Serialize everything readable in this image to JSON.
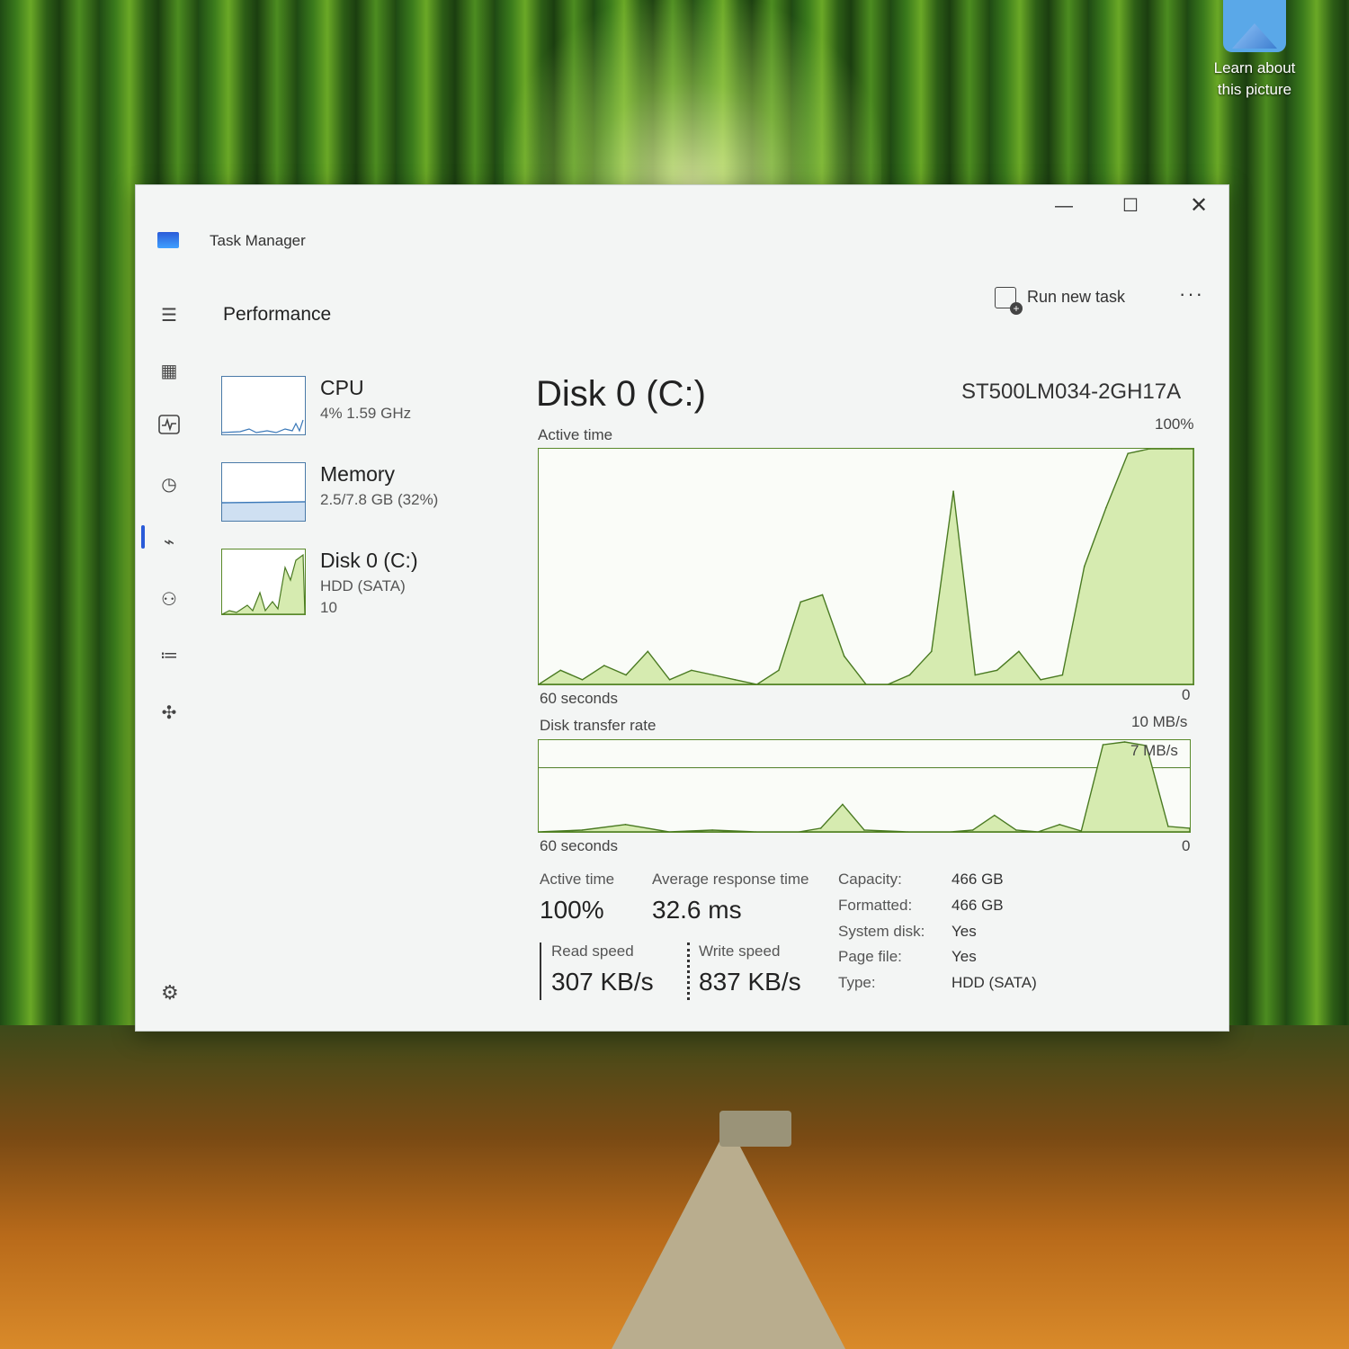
{
  "desktop": {
    "icon_label_line1": "Learn about",
    "icon_label_line2": "this picture"
  },
  "window": {
    "title": "Task Manager",
    "controls": {
      "minimize": "—",
      "maximize": "☐",
      "close": "✕"
    }
  },
  "nav": {
    "icons": [
      "menu-icon",
      "processes-icon",
      "performance-icon",
      "app-history-icon",
      "startup-apps-icon",
      "users-icon",
      "details-icon",
      "services-icon"
    ],
    "active": "performance-icon",
    "settings_icon": "gear-icon"
  },
  "page": {
    "title": "Performance",
    "run_new_task": "Run new task",
    "more": "···"
  },
  "devices": [
    {
      "name": "CPU",
      "sub": "4% 1.59 GHz"
    },
    {
      "name": "Memory",
      "sub": "2.5/7.8 GB (32%)"
    },
    {
      "name": "Disk 0 (C:)",
      "sub": "HDD (SATA)",
      "sub2": "10"
    }
  ],
  "disk": {
    "title": "Disk 0 (C:)",
    "model": "ST500LM034-2GH17A",
    "active_time_label": "Active time",
    "active_max": "100%",
    "active_min": "0",
    "active_span": "60 seconds",
    "transfer_label": "Disk transfer rate",
    "transfer_max": "10 MB/s",
    "transfer_line": "7 MB/s",
    "transfer_min": "0",
    "transfer_span": "60 seconds",
    "stats": {
      "active_time_label": "Active time",
      "active_time": "100%",
      "avg_response_label": "Average response time",
      "avg_response": "32.6 ms",
      "read_label": "Read speed",
      "read": "307 KB/s",
      "write_label": "Write speed",
      "write": "837 KB/s"
    },
    "properties": [
      {
        "k": "Capacity:",
        "v": "466 GB"
      },
      {
        "k": "Formatted:",
        "v": "466 GB"
      },
      {
        "k": "System disk:",
        "v": "Yes"
      },
      {
        "k": "Page file:",
        "v": "Yes"
      },
      {
        "k": "Type:",
        "v": "HDD (SATA)"
      }
    ]
  },
  "colors": {
    "disk_line": "#4a7a22",
    "disk_fill": "#d6ebb0",
    "cpu_line": "#3a78b8",
    "accent": "#2a5bd8"
  },
  "chart_data": [
    {
      "type": "area",
      "title": "Active time",
      "xlabel": "60 seconds",
      "ylabel": "",
      "ylim": [
        0,
        100
      ],
      "x": [
        60,
        58,
        56,
        54,
        52,
        50,
        48,
        46,
        44,
        42,
        40,
        38,
        36,
        34,
        32,
        30,
        28,
        26,
        24,
        22,
        20,
        18,
        16,
        14,
        12,
        10,
        8,
        6,
        4,
        2,
        0
      ],
      "series": [
        {
          "values": [
            0,
            6,
            2,
            8,
            4,
            14,
            2,
            6,
            4,
            2,
            0,
            6,
            35,
            38,
            12,
            0,
            0,
            4,
            14,
            82,
            4,
            6,
            14,
            2,
            4,
            50,
            75,
            98,
            100,
            100,
            100
          ]
        }
      ]
    },
    {
      "type": "area",
      "title": "Disk transfer rate",
      "xlabel": "60 seconds",
      "ylabel": "",
      "ylim": [
        0,
        10
      ],
      "x": [
        60,
        56,
        52,
        48,
        44,
        40,
        36,
        34,
        32,
        30,
        26,
        22,
        20,
        18,
        16,
        14,
        12,
        10,
        8,
        6,
        4,
        2,
        0
      ],
      "series": [
        {
          "values": [
            0,
            0.2,
            0.8,
            0,
            0.2,
            0,
            0,
            0.4,
            3,
            0.2,
            0,
            0,
            0.2,
            1.8,
            0.2,
            0,
            0.8,
            0.1,
            9.5,
            9.8,
            9.4,
            0.6,
            0.4
          ]
        }
      ]
    }
  ]
}
